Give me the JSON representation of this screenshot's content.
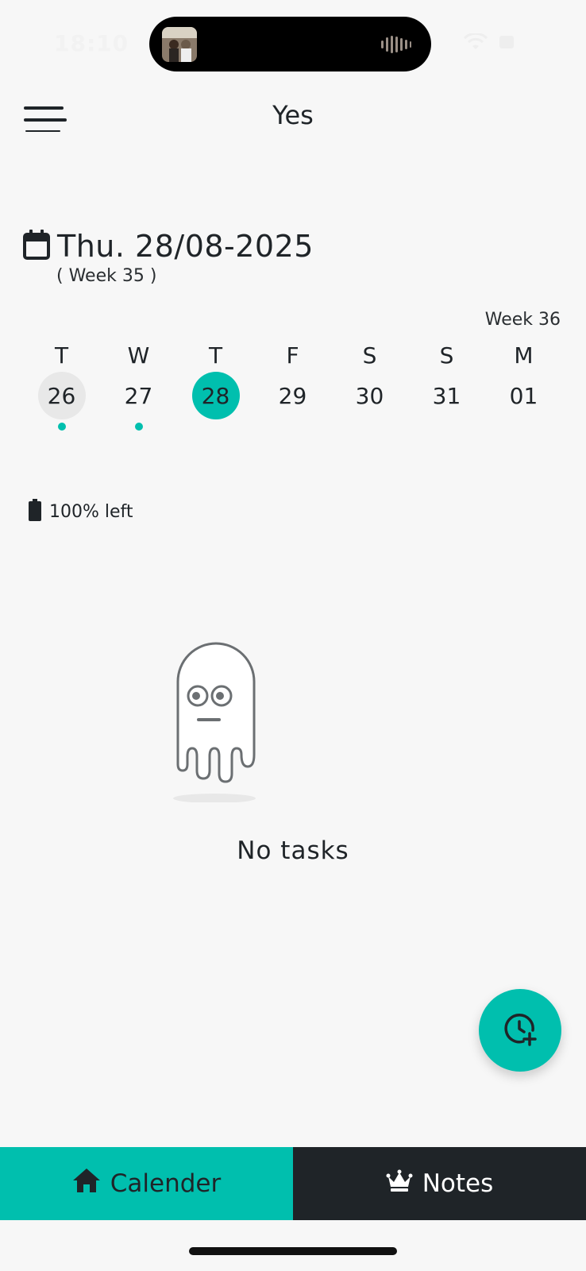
{
  "status_bar": {
    "time": "18:10",
    "icons": [
      "album-art-icon",
      "audio-wave-icon",
      "wifi-icon",
      "battery-icon"
    ]
  },
  "header": {
    "title": "Yes",
    "menu_icon": "hamburger-menu-icon"
  },
  "date_header": {
    "date": "Thu. 28/08-2025",
    "week": "( Week 35 )",
    "icon": "calendar-icon"
  },
  "week_strip": {
    "next_week_label": "Week 36",
    "days": [
      {
        "letter": "T",
        "number": "26",
        "state": "today",
        "has_tasks": true
      },
      {
        "letter": "W",
        "number": "27",
        "state": "normal",
        "has_tasks": true
      },
      {
        "letter": "T",
        "number": "28",
        "state": "selected",
        "has_tasks": false
      },
      {
        "letter": "F",
        "number": "29",
        "state": "normal",
        "has_tasks": false
      },
      {
        "letter": "S",
        "number": "30",
        "state": "normal",
        "has_tasks": false
      },
      {
        "letter": "S",
        "number": "31",
        "state": "normal",
        "has_tasks": false
      },
      {
        "letter": "M",
        "number": "01",
        "state": "normal",
        "has_tasks": false
      }
    ]
  },
  "capacity": {
    "text": "100% left",
    "icon": "battery-icon"
  },
  "empty_state": {
    "text": "No tasks",
    "illustration": "ghost-icon"
  },
  "fab": {
    "icon": "add-alarm-icon"
  },
  "bottom_nav": {
    "tabs": [
      {
        "label": "Calender",
        "icon": "home-icon",
        "active": true
      },
      {
        "label": "Notes",
        "icon": "crown-icon",
        "active": false
      }
    ]
  },
  "colors": {
    "accent": "#00bfae",
    "dark": "#1f2428",
    "background": "#f7f7f7"
  }
}
